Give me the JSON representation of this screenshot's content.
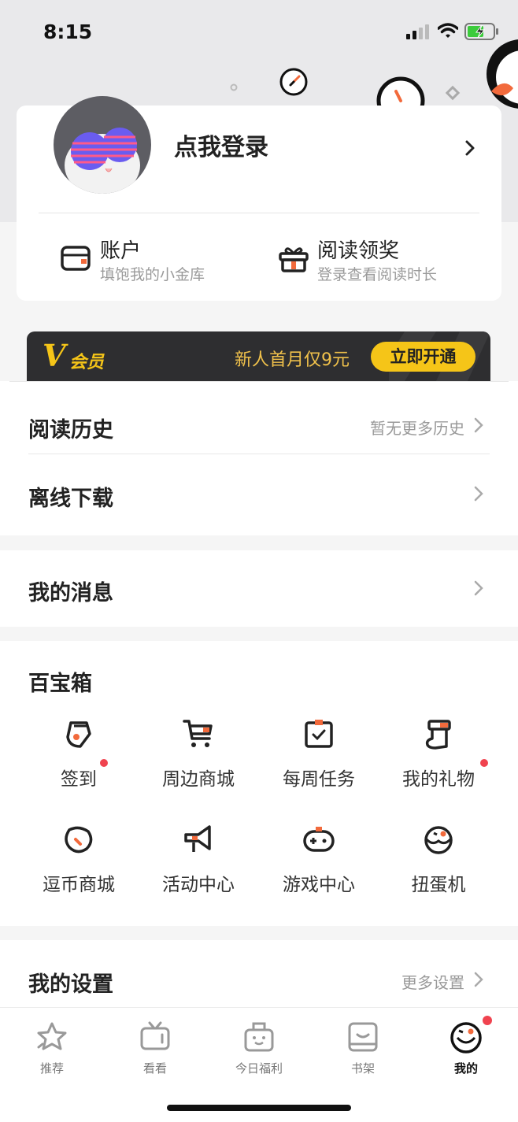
{
  "status_bar": {
    "time": "8:15"
  },
  "profile": {
    "login_label": "点我登录",
    "account": {
      "title": "账户",
      "subtitle": "填饱我的小金库"
    },
    "reading_reward": {
      "title": "阅读领奖",
      "subtitle": "登录查看阅读时长"
    }
  },
  "vip": {
    "logo": "V",
    "label": "会员",
    "promo": "新人首月仅9元",
    "button": "立即开通"
  },
  "list1": {
    "history": {
      "label": "阅读历史",
      "hint": "暂无更多历史"
    },
    "offline": {
      "label": "离线下载"
    }
  },
  "list2": {
    "messages": {
      "label": "我的消息"
    }
  },
  "toolbox": {
    "title": "百宝箱",
    "items": [
      {
        "label": "签到",
        "icon": "sign-in-icon",
        "badge": true
      },
      {
        "label": "周边商城",
        "icon": "cart-icon",
        "badge": false
      },
      {
        "label": "每周任务",
        "icon": "task-icon",
        "badge": false
      },
      {
        "label": "我的礼物",
        "icon": "gift-sock-icon",
        "badge": true
      },
      {
        "label": "逗币商城",
        "icon": "coin-icon",
        "badge": false
      },
      {
        "label": "活动中心",
        "icon": "megaphone-icon",
        "badge": false
      },
      {
        "label": "游戏中心",
        "icon": "gamepad-icon",
        "badge": false
      },
      {
        "label": "扭蛋机",
        "icon": "capsule-icon",
        "badge": false
      }
    ]
  },
  "settings": {
    "label": "我的设置",
    "hint": "更多设置"
  },
  "tabs": [
    {
      "label": "推荐",
      "icon": "star-icon",
      "active": false
    },
    {
      "label": "看看",
      "icon": "tv-icon",
      "active": false
    },
    {
      "label": "今日福利",
      "icon": "gift-box-icon",
      "active": false
    },
    {
      "label": "书架",
      "icon": "bookshelf-icon",
      "active": false
    },
    {
      "label": "我的",
      "icon": "mascot-icon",
      "active": true
    }
  ],
  "colors": {
    "accent": "#f26a3c",
    "vip_gold": "#f5c518",
    "badge_red": "#f0434f",
    "vip_bg": "#2e2e30"
  }
}
